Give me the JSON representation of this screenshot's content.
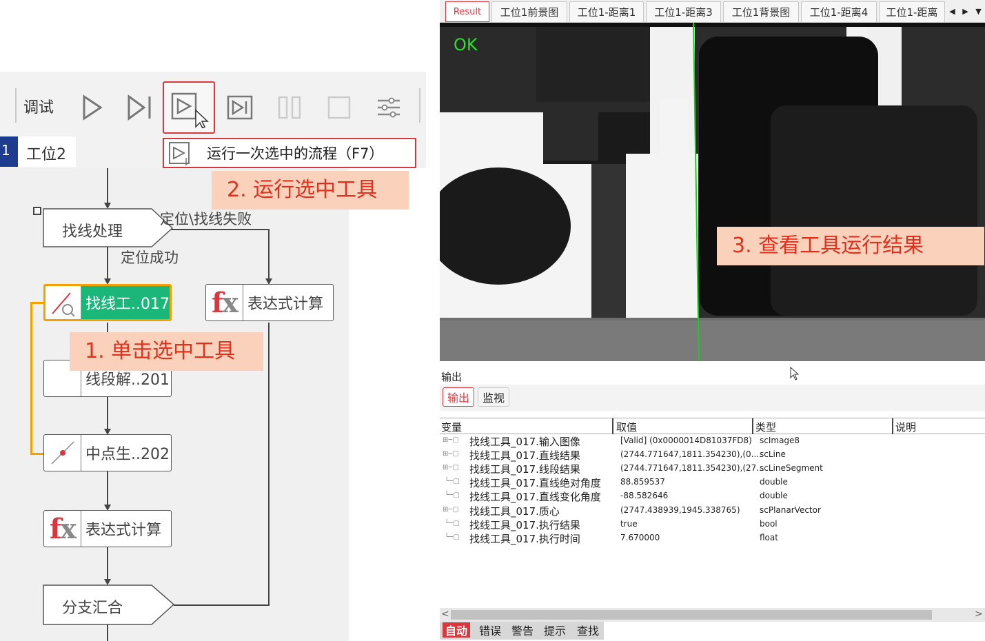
{
  "toolbar": {
    "title": "调试"
  },
  "tabs": {
    "index": "1",
    "workpos": "工位2"
  },
  "tooltip": {
    "text": "运行一次选中的流程（F7）"
  },
  "callouts": {
    "step1": "1. 单击选中工具",
    "step2": "2. 运行选中工具",
    "step3": "3. 查看工具运行结果"
  },
  "flow": {
    "find_line_proc": "找线处理",
    "edge_fail": "定位\\找线失败",
    "edge_success": "定位成功",
    "tool_findline": "找线工..017",
    "tool_expr_right": "表达式计算",
    "tool_segment": "线段解..201",
    "tool_midpoint": "中点生..202",
    "tool_expr": "表达式计算",
    "branch_merge": "分支汇合"
  },
  "image_tabs": [
    "Result",
    "工位1前景图",
    "工位1-距离1",
    "工位1-距离3",
    "工位1背景图",
    "工位1-距离4",
    "工位1-距离"
  ],
  "image_view": {
    "status": "OK"
  },
  "output": {
    "title": "输出",
    "tabs": [
      "输出",
      "监视"
    ],
    "columns": [
      "变量",
      "取值",
      "类型",
      "说明"
    ],
    "rows": [
      {
        "name": "找线工具_017.输入图像",
        "value": "[Valid] (0x0000014D81037FD8)",
        "type": "scImage8"
      },
      {
        "name": "找线工具_017.直线结果",
        "value": "(2744.771647,1811.354230),(0....",
        "type": "scLine"
      },
      {
        "name": "找线工具_017.线段结果",
        "value": "(2744.771647,1811.354230),(27...",
        "type": "scLineSegment"
      },
      {
        "name": "找线工具_017.直线绝对角度",
        "value": "88.859537",
        "type": "double"
      },
      {
        "name": "找线工具_017.直线变化角度",
        "value": "-88.582646",
        "type": "double"
      },
      {
        "name": "找线工具_017.质心",
        "value": "(2747.438939,1945.338765)",
        "type": "scPlanarVector"
      },
      {
        "name": "找线工具_017.执行结果",
        "value": "true",
        "type": "bool"
      },
      {
        "name": "找线工具_017.执行时间",
        "value": "7.670000",
        "type": "float"
      }
    ]
  },
  "status_tabs": [
    "自动",
    "错误",
    "警告",
    "提示",
    "查找"
  ],
  "colors": {
    "accent": "#d9363e",
    "ok": "#27e227",
    "selected_tool": "#1ab67a",
    "highlight_border": "#f2a100"
  }
}
